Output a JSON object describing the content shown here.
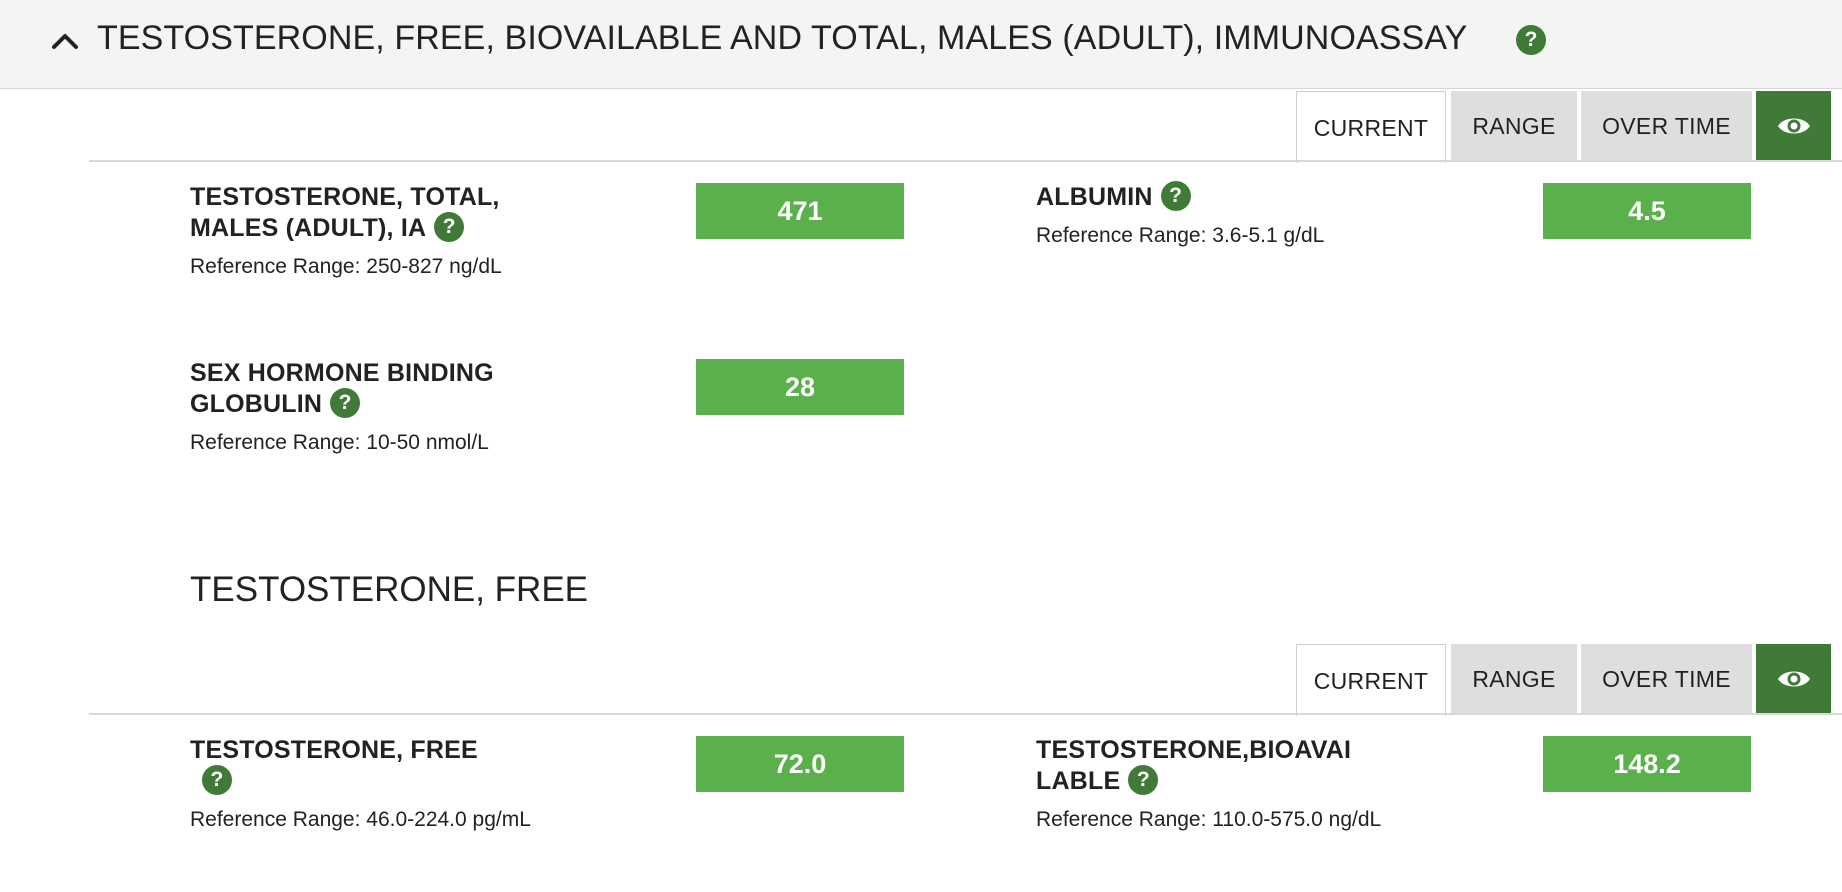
{
  "panel": {
    "title": "TESTOSTERONE, FREE, BIOVAILABLE AND TOTAL, MALES (ADULT), IMMUNOASSAY",
    "help_glyph": "?",
    "icons": {
      "collapse": "chevron-up-icon",
      "help": "help-icon",
      "view": "eye-icon"
    },
    "colors": {
      "value_bg": "#5ab14b",
      "help_bg": "#3f7a36",
      "eye_bg": "#3f7a36"
    }
  },
  "tabs": {
    "current": "CURRENT",
    "range": "RANGE",
    "over_time": "OVER TIME"
  },
  "group1": {
    "results": [
      {
        "name": "TESTOSTERONE, TOTAL, MALES (ADULT), IA",
        "value": "471",
        "reference": "Reference Range: 250-827 ng/dL"
      },
      {
        "name": "ALBUMIN",
        "value": "4.5",
        "reference": "Reference Range: 3.6-5.1 g/dL"
      },
      {
        "name": "SEX HORMONE BINDING GLOBULIN",
        "value": "28",
        "reference": "Reference Range: 10-50 nmol/L"
      }
    ]
  },
  "group2": {
    "title": "TESTOSTERONE, FREE",
    "results": [
      {
        "name": "TESTOSTERONE, FREE",
        "value": "72.0",
        "reference": "Reference Range: 46.0-224.0 pg/mL"
      },
      {
        "name": "TESTOSTERONE,BIOAVAILABLE",
        "name_wrapped": "TESTOSTERONE,BIOAVAI LABLE",
        "value": "148.2",
        "reference": "Reference Range: 110.0-575.0 ng/dL"
      }
    ]
  }
}
